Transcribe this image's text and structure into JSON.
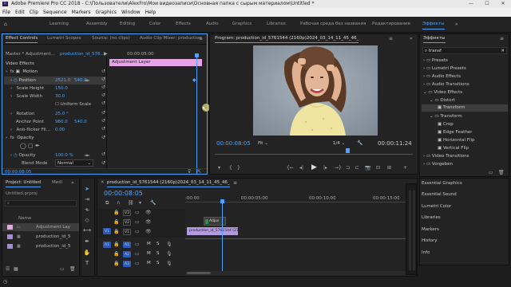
{
  "titlebar": {
    "text": "Adobe Premiere Pro CC 2018 - C:\\Пользователи\\AlexFro\\Мои видеозаписи\\Основная папка с сырым материалом\\Untitled *",
    "icon": "Pr"
  },
  "menu": [
    "File",
    "Edit",
    "Clip",
    "Sequence",
    "Markers",
    "Graphics",
    "Window",
    "Help"
  ],
  "workspaces": [
    "Learning",
    "Assembly",
    "Editing",
    "Color",
    "Effects",
    "Audio",
    "Graphics",
    "Libraries",
    "Рабочая среда без названия",
    "Редактирование",
    "Эффекты"
  ],
  "workspace_active": "Эффекты",
  "ec": {
    "tabs": [
      "Effect Controls",
      "Lumetri Scopes",
      "Source: (no clips)",
      "Audio Clip Mixer: production"
    ],
    "master": "Master * Adjustment...",
    "clip": "production_id_576...",
    "timecode_head": "00:00:05:00",
    "adj_label": "Adjustment Layer",
    "video_effects": "Video Effects",
    "motion": "Motion",
    "position": {
      "label": "Position",
      "x": "2521.0",
      "y": "540.0"
    },
    "scale_height": {
      "label": "Scale Height",
      "v": "150.0"
    },
    "scale_width": {
      "label": "Scale Width",
      "v": "30.0"
    },
    "uniform": "Uniform Scale",
    "rotation": {
      "label": "Rotation",
      "v": "25.0 °"
    },
    "anchor": {
      "label": "Anchor Point",
      "x": "960.0",
      "y": "540.0"
    },
    "antiflicker": {
      "label": "Anti-flicker Fil...",
      "v": "0.00"
    },
    "opacity_fx": "Opacity",
    "opacity": {
      "label": "Opacity",
      "v": "100.0 %"
    },
    "blend": {
      "label": "Blend Mode",
      "v": "Normal"
    },
    "time": "00:00:08:05"
  },
  "program": {
    "title": "Program: production_id_5761544 (2160p)2024_03_14_11_45_46_",
    "timecode": "00:00:08:05",
    "fit": "Fit",
    "quality": "1/4",
    "duration": "00:00:11:24"
  },
  "effects": {
    "tab": "Эффекты",
    "search": "transf",
    "items": [
      "Presets",
      "Lumetri Presets",
      "Audio Effects",
      "Audio Transitions",
      "Video Effects",
      "Distort",
      "Transform",
      "Transform",
      "Crop",
      "Edge Feather",
      "Horizontal Flip",
      "Vertical Flip",
      "Video Transitions",
      "Vorgeben"
    ],
    "right_items": [
      "Essential Graphics",
      "Essential Sound",
      "Lumetri Color",
      "Libraries",
      "Markers",
      "History",
      "Info"
    ]
  },
  "project": {
    "tabs": [
      "Project: Untitled",
      "Medi"
    ],
    "file": "Untitled.prproj",
    "name_header": "Name",
    "items": [
      "Adjustment Lay",
      "production_id_5",
      "production_id_5"
    ],
    "colors": [
      "#e4a8e8",
      "#a78bd8",
      "#a78bd8"
    ]
  },
  "timeline": {
    "tab": "production_id_5761544 (2160p)2024_03_14_11_45_46_",
    "timecode": "00:00:08:05",
    "ruler": [
      ":00:00",
      "00:00:05:00",
      "00:00:10:00",
      "00:00:15:00"
    ],
    "tracks_v": [
      "V3",
      "V2",
      "V1"
    ],
    "tracks_a": [
      "A1",
      "A2",
      "A3"
    ],
    "v1_src": "V1",
    "a1_src": "A1",
    "clip_adj": "Adjus",
    "clip_main": "production_id_5761544 (2160p"
  }
}
